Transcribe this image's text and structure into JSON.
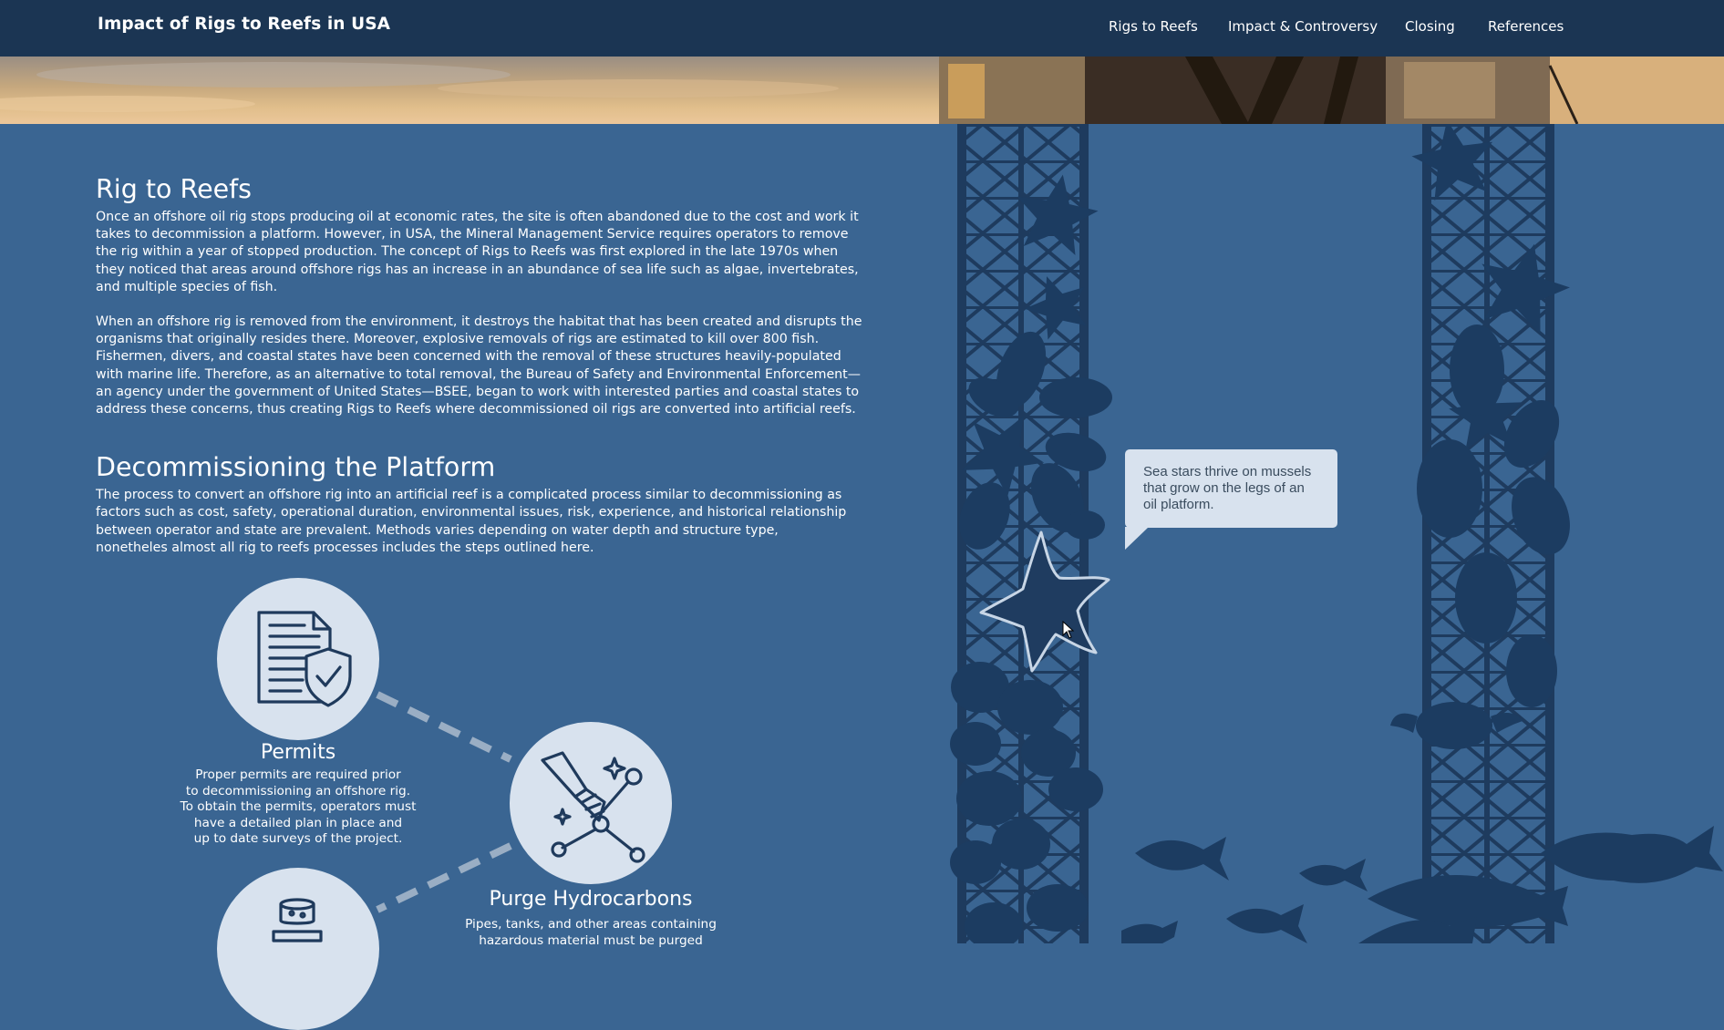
{
  "nav": {
    "brand": "Impact of Rigs to Reefs in USA",
    "links": [
      "Rigs to Reefs",
      "Impact & Controversy",
      "Closing",
      "References"
    ]
  },
  "section1": {
    "title": "Rig to Reefs",
    "paragraphs": [
      "Once an offshore oil rig stops producing oil at economic rates, the site is often abandoned due to the cost and work it takes to decommission a platform. However, in USA, the Mineral Management Service requires operators to remove the rig within a year of stopped production. The concept of Rigs to Reefs was first explored in the late 1970s when they noticed that areas around offshore rigs has an increase in an abundance of sea life such as algae, invertebrates, and multiple species of fish.",
      "When an offshore rig is removed from the environment, it destroys the habitat that has been created and disrupts the organisms that originally resides there. Moreover, explosive removals of rigs are estimated to kill over 800 fish. Fishermen, divers, and coastal states have been concerned with the removal of these structures heavily-populated with marine life. Therefore, as an alternative to total removal, the Bureau of Safety and Environmental Enforcement—an agency under the government of United States—BSEE, began to work with interested parties and coastal states to address these concerns, thus creating Rigs to Reefs where decommissioned oil rigs are converted into artificial reefs."
    ]
  },
  "section2": {
    "title": "Decommissioning the Platform",
    "paragraph": "The process to convert an offshore rig into an artificial reef is a complicated process similar to decommissioning as factors such as cost, safety, operational duration, environmental issues, risk, experience, and historical relationship between operator and state are prevalent. Methods varies depending on water depth and structure type, nonetheles almost all rig to reefs processes includes the steps outlined here."
  },
  "steps": [
    {
      "title": "Permits",
      "icon": "permit-document-icon",
      "desc": "Proper permits are required prior\nto decommissioning an offshore rig.\nTo obtain the permits, operators must\nhave  a detailed plan in place and\nup to date surveys of the project."
    },
    {
      "title": "Purge Hydrocarbons",
      "icon": "cleaning-brush-icon",
      "desc": "Pipes, tanks, and other areas containing\nhazardous material must be purged"
    },
    {
      "title": "",
      "icon": "jar-icon",
      "desc": ""
    }
  ],
  "tooltip": {
    "text": "Sea stars thrive on mussels that grow on the legs of an oil platform."
  },
  "colors": {
    "background": "#3a6592",
    "navbar": "#1b3553",
    "circle": "#d8e2ee",
    "silhouette": "#1c3c61"
  }
}
